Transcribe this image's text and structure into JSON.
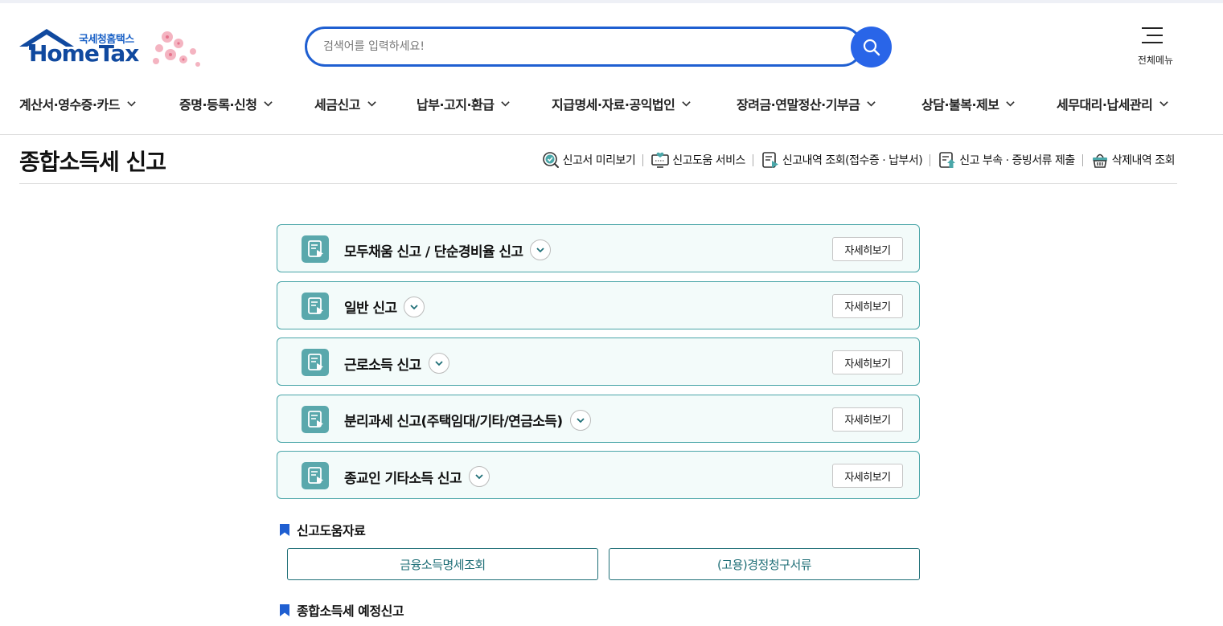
{
  "header": {
    "logo_kr": "국세청홈택스",
    "logo_en": "HomeTax",
    "search_placeholder": "검색어를 입력하세요!",
    "all_menu_label": "전체메뉴"
  },
  "gnb": {
    "items": [
      {
        "label": "계산서·영수증·카드"
      },
      {
        "label": "증명·등록·신청"
      },
      {
        "label": "세금신고"
      },
      {
        "label": "납부·고지·환급"
      },
      {
        "label": "지급명세·자료·공익법인"
      },
      {
        "label": "장려금·연말정산·기부금"
      },
      {
        "label": "상담·불복·제보"
      },
      {
        "label": "세무대리·납세관리"
      }
    ]
  },
  "page": {
    "title": "종합소득세 신고",
    "quick_links": [
      {
        "label": "신고서 미리보기",
        "icon": "search-check-icon"
      },
      {
        "label": "신고도움 서비스",
        "icon": "monitor-heart-icon"
      },
      {
        "label": "신고내역 조회(접수증 · 납부서)",
        "icon": "document-play-icon"
      },
      {
        "label": "신고 부속 · 증빙서류 제출",
        "icon": "document-upload-icon"
      },
      {
        "label": "삭제내역 조회",
        "icon": "basket-icon"
      }
    ]
  },
  "cards": [
    {
      "title": "모두채움 신고 / 단순경비율 신고",
      "detail_label": "자세히보기"
    },
    {
      "title": "일반 신고",
      "detail_label": "자세히보기"
    },
    {
      "title": "근로소득 신고",
      "detail_label": "자세히보기"
    },
    {
      "title": "분리과세 신고(주택임대/기타/연금소득)",
      "detail_label": "자세히보기"
    },
    {
      "title": "종교인 기타소득 신고",
      "detail_label": "자세히보기"
    }
  ],
  "help_section": {
    "title": "신고도움자료",
    "buttons": [
      {
        "label": "금융소득명세조회"
      },
      {
        "label": "(고용)경정청구서류"
      }
    ]
  },
  "provisional_section": {
    "title": "종합소득세 예정신고"
  },
  "colors": {
    "brand_blue": "#1f5fd1",
    "search_button": "#2965e8",
    "card_border": "#49a5a8",
    "card_bg": "#f3fbfa",
    "card_icon": "#5aa8ac",
    "link_button_text": "#1f6f77",
    "bookmark": "#1f5fd1"
  }
}
